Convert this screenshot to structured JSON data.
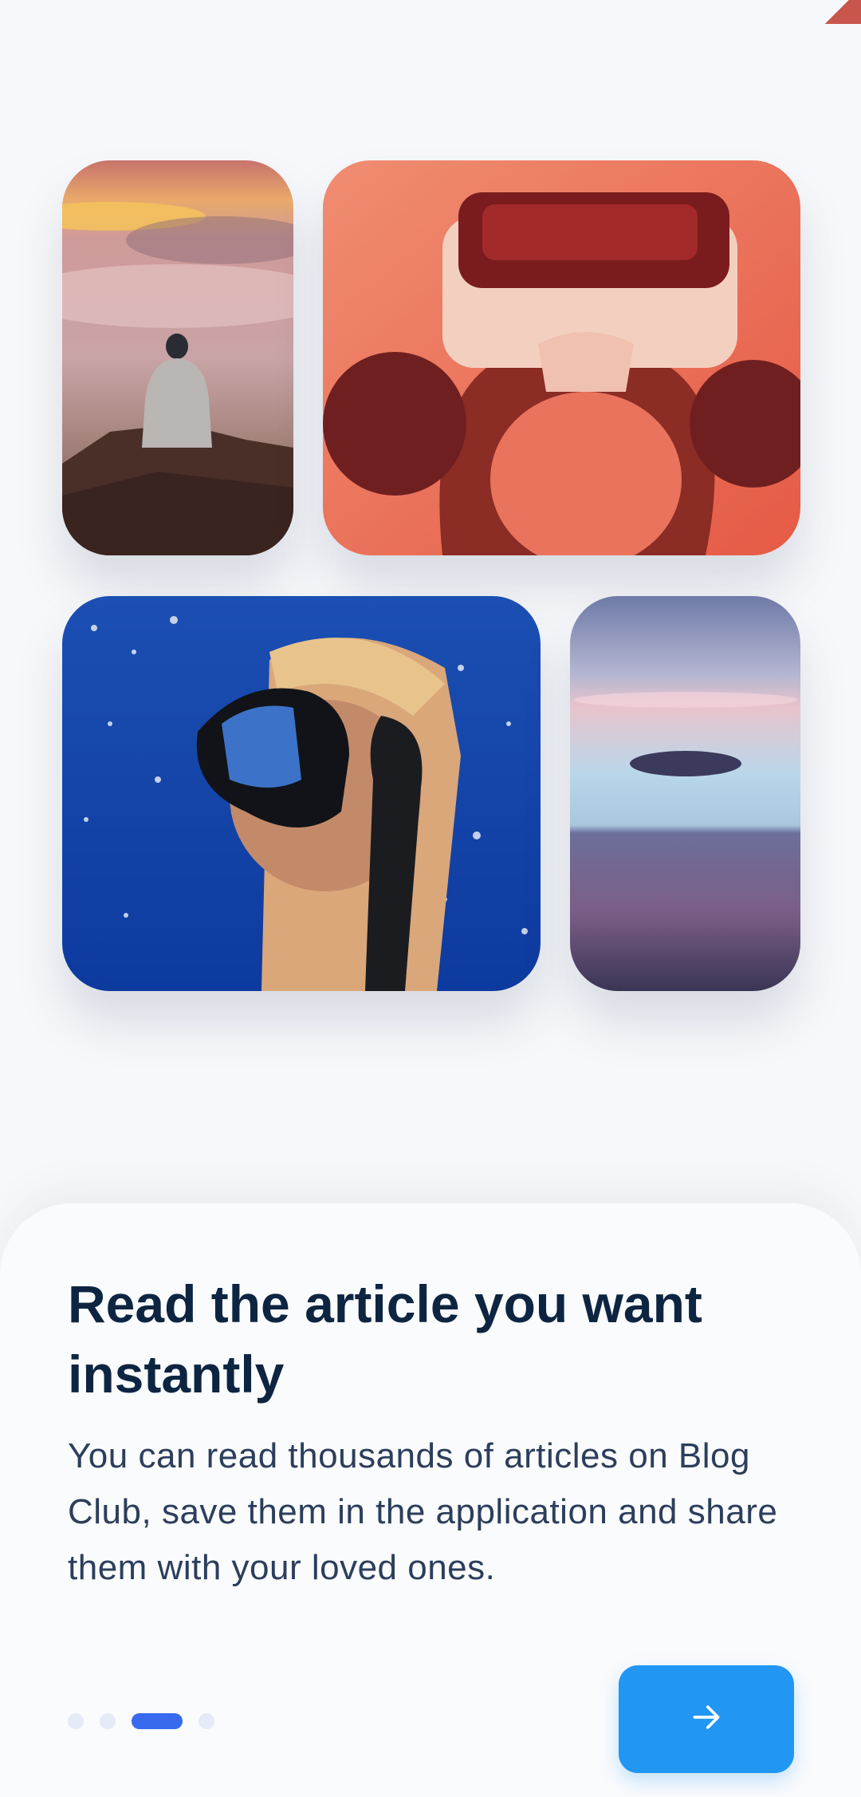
{
  "onboarding": {
    "title": "Read the article you want instantly",
    "description": "You can read thousands of articles on Blog Club, save them in the application and share them with your loved ones.",
    "page_indicator": {
      "total": 4,
      "current": 3
    },
    "next_button": {
      "icon": "arrow-right-icon"
    },
    "images": [
      "mountain-sunset-photo",
      "vr-headset-photo",
      "diver-underwater-photo",
      "sea-horizon-photo"
    ]
  },
  "colors": {
    "accent": "#376aed",
    "button": "#2196f3",
    "title": "#0d2541",
    "text": "#2c3e5c",
    "background": "#f7f8fb"
  }
}
